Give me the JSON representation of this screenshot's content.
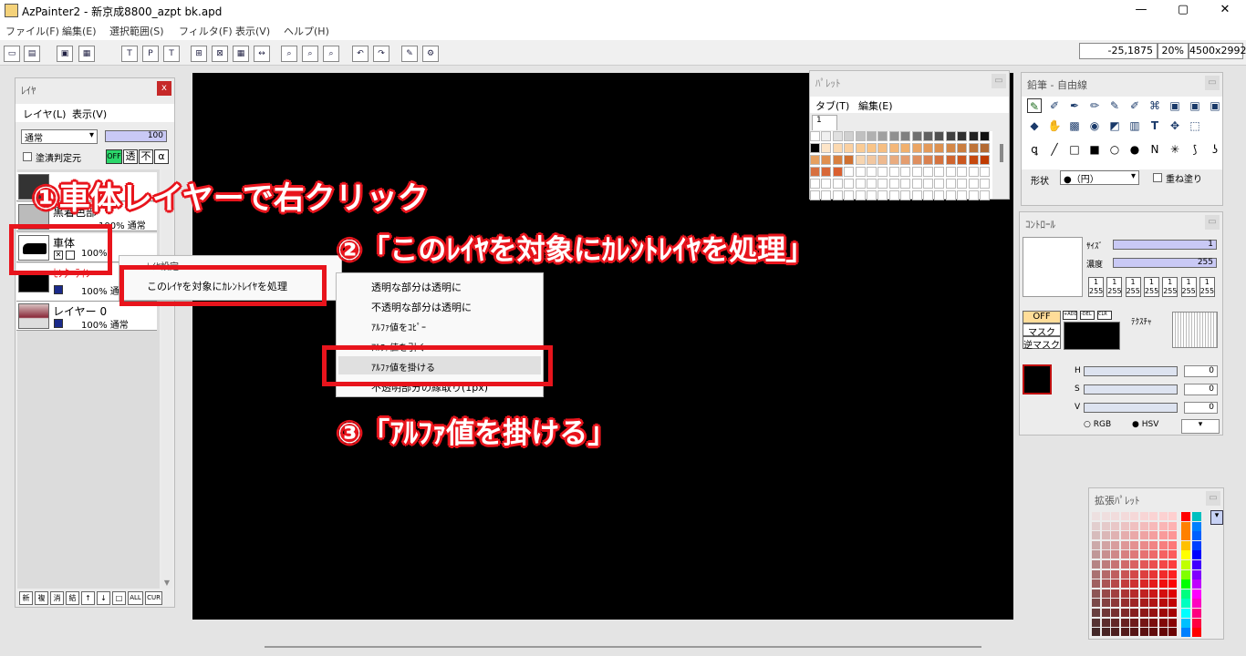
{
  "window": {
    "title": "AzPainter2 - 新京成8800_azpt bk.apd",
    "min": "—",
    "max": "▢",
    "close": "✕"
  },
  "menu": [
    "ファイル(F)",
    "編集(E)",
    "選択範囲(S)",
    "フィルタ(F)",
    "表示(V)",
    "ヘルプ(H)"
  ],
  "status": {
    "coords": "-25,1875",
    "zoom": "20%",
    "size": "4500x2992"
  },
  "toolbar_icons": [
    "new-icon",
    "open-icon",
    "save-icon",
    "saveas-icon",
    "text-icon",
    "layer-icon",
    "grid-icon",
    "ruler-icon",
    "zoom-out-icon",
    "zoom-in-icon",
    "zoom-reset-icon",
    "undo-icon",
    "redo-icon",
    "pen-icon",
    "filter-icon"
  ],
  "layer_panel": {
    "title": "ﾚｲﾔ",
    "close": "x",
    "menu": [
      "レイヤ(L)",
      "表示(V)"
    ],
    "blend": "通常",
    "opacity": "100",
    "fill_check": "塗潰判定元",
    "mode_buttons": [
      "OFF",
      "透",
      "不",
      "α"
    ],
    "layers": [
      {
        "name": "",
        "prop": ""
      },
      {
        "name": "黒着色部",
        "prop": "100% 通常"
      },
      {
        "name": "車体",
        "prop": "100%"
      },
      {
        "name": "ｾﾝﾀｰﾗｲﾝ",
        "prop": "100% 通"
      },
      {
        "name": "レイヤー 0",
        "prop": "100% 通常"
      }
    ],
    "bottom_buttons": [
      "新",
      "複",
      "消",
      "結",
      "↑",
      "↓",
      "□",
      "ALL",
      "CUR"
    ]
  },
  "context_menu": {
    "header": "ﾚｲﾔ設定",
    "item": "このﾚｲﾔを対象にｶﾚﾝﾄﾚｲﾔを処理"
  },
  "submenu": [
    "透明な部分は透明に",
    "不透明な部分は透明に",
    "ｱﾙﾌｧ値をｺﾋﾟｰ",
    "ｱﾙﾌｧ値を引く",
    "ｱﾙﾌｧ値を掛ける",
    "不透明部分の縁取り(1px)"
  ],
  "annotations": {
    "step1": "①車体レイヤーで右クリック",
    "step2": "②「このﾚｲﾔを対象にｶﾚﾝﾄﾚｲﾔを処理」",
    "step3": "③「ｱﾙﾌｧ値を掛ける」",
    "color": "#e8141c"
  },
  "palette": {
    "title": "ﾊﾟﾚｯﾄ",
    "menu": [
      "タブ(T)",
      "編集(E)"
    ],
    "tab": "1"
  },
  "pen_panel": {
    "title": "鉛筆 - 自由線",
    "shape_label": "形状",
    "shape_value": "●（円）",
    "overlay": "重ね塗り"
  },
  "control_panel": {
    "title": "ｺﾝﾄﾛｰﾙ",
    "size_label": "ｻｲｽﾞ",
    "size_value": "1",
    "density_label": "濃度",
    "density_value": "255",
    "presets": [
      "1\n255",
      "1\n255",
      "1\n255",
      "1\n255",
      "1\n255",
      "1\n255",
      "1\n255"
    ],
    "mask": [
      "OFF",
      "マスク",
      "逆マスク"
    ],
    "mask_buttons": [
      "+ADD",
      "-DEL",
      "CLR"
    ],
    "texture": "ﾃｸｽﾁｬ",
    "hsv": [
      {
        "label": "H",
        "value": "0"
      },
      {
        "label": "S",
        "value": "0"
      },
      {
        "label": "V",
        "value": "0"
      }
    ],
    "mode": [
      "RGB",
      "HSV"
    ]
  },
  "ext_palette": {
    "title": "拡張ﾊﾟﾚｯﾄ"
  }
}
